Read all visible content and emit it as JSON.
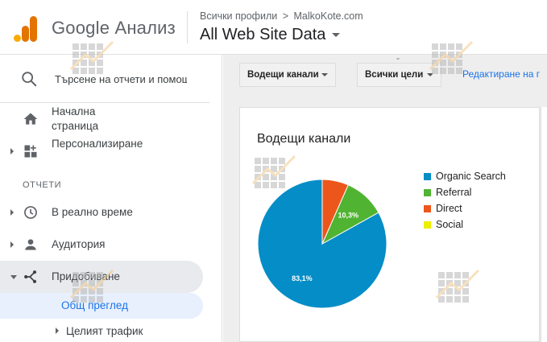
{
  "header": {
    "app_name": "Google Анализ",
    "breadcrumb": {
      "all_profiles": "Всички профили",
      "separator": ">",
      "account": "MalkoKote.com"
    },
    "property_name": "All Web Site Data",
    "logo_colors": [
      "#f9ab00",
      "#e37400",
      "#e37400"
    ]
  },
  "sidebar": {
    "search_placeholder": "Търсене на отчети и помощ",
    "home_label": "Начална страница",
    "customization_label": "Персонализиране",
    "section_reports": "ОТЧЕТИ",
    "realtime_label": "В реално време",
    "audience_label": "Аудитория",
    "acquisition_label": "Придобиване",
    "overview_label": "Общ преглед",
    "all_traffic_label": "Целият трафик"
  },
  "toolbar": {
    "channels_dropdown": "Водещи канали",
    "goals_dropdown": "Всички цели",
    "edit_link": "Редактиране на г",
    "stray_mark": "-"
  },
  "chart_data": {
    "type": "pie",
    "title": "Водещи канали",
    "series": [
      {
        "name": "Organic Search",
        "value": 83.1,
        "label": "83,1%",
        "color": "#058dc7"
      },
      {
        "name": "Referral",
        "value": 10.3,
        "label": "10,3%",
        "color": "#50b432"
      },
      {
        "name": "Direct",
        "value": 6.6,
        "label": "",
        "color": "#ed561b"
      },
      {
        "name": "Social",
        "value": 0.0,
        "label": "",
        "color": "#edef00"
      }
    ],
    "legend_position": "right"
  }
}
